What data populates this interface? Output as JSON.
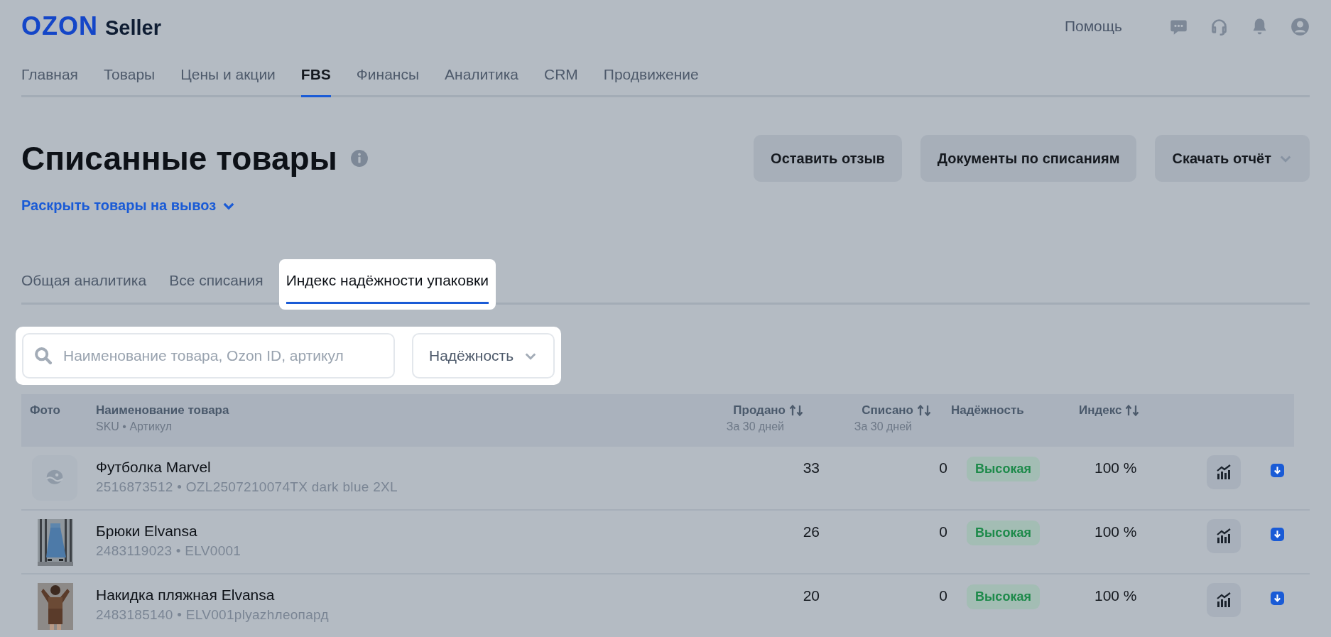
{
  "header": {
    "logo": "OZON",
    "logo_suffix": "Seller",
    "help": "Помощь"
  },
  "nav": [
    {
      "label": "Главная",
      "selected": false
    },
    {
      "label": "Товары",
      "selected": false
    },
    {
      "label": "Цены и акции",
      "selected": false
    },
    {
      "label": "FBS",
      "selected": true
    },
    {
      "label": "Финансы",
      "selected": false
    },
    {
      "label": "Аналитика",
      "selected": false
    },
    {
      "label": "CRM",
      "selected": false
    },
    {
      "label": "Продвижение",
      "selected": false
    }
  ],
  "page": {
    "title": "Списанные товары",
    "expand_link": "Раскрыть товары на вывоз"
  },
  "actions": [
    {
      "label": "Оставить отзыв",
      "dropdown": false
    },
    {
      "label": "Документы по списаниям",
      "dropdown": false
    },
    {
      "label": "Скачать отчёт",
      "dropdown": true
    }
  ],
  "tabs": [
    {
      "label": "Общая аналитика",
      "selected": false,
      "highlighted": false
    },
    {
      "label": "Все списания",
      "selected": false,
      "highlighted": false
    },
    {
      "label": "Индекс надёжности упаковки",
      "selected": true,
      "highlighted": true
    }
  ],
  "filters": {
    "search": {
      "placeholder": "Наименование товара, Ozon ID, артикул"
    },
    "reliability": "Надёжность"
  },
  "table": {
    "columns": [
      {
        "label": "Фото",
        "sortable": false
      },
      {
        "label": "Наименование товара",
        "sub": "SKU • Артикул",
        "sortable": false
      },
      {
        "label": "Продано",
        "sub": "За 30 дней",
        "sortable": true
      },
      {
        "label": "Списано",
        "sub": "За 30 дней",
        "sortable": true
      },
      {
        "label": "Надёжность",
        "sortable": false
      },
      {
        "label": "Индекс",
        "sortable": true
      }
    ],
    "rows": [
      {
        "photo": {
          "kind": "placeholder"
        },
        "name": "Футболка Marvel",
        "sku": "2516873512 • OZL2507210074TX dark blue 2XL",
        "sold": "33",
        "written_off": "0",
        "reliability": "Высокая",
        "index": "100 %"
      },
      {
        "name": "Брюки Elvansa",
        "sku": "2483119023 • ELV0001",
        "sold": "26",
        "written_off": "0",
        "reliability": "Высокая",
        "index": "100 %"
      },
      {
        "name": "Накидка пляжная Elvansa",
        "sku": "2483185140 • ELV001plyazhлеопард",
        "sold": "20",
        "written_off": "0",
        "reliability": "Высокая",
        "index": "100 %"
      }
    ]
  }
}
